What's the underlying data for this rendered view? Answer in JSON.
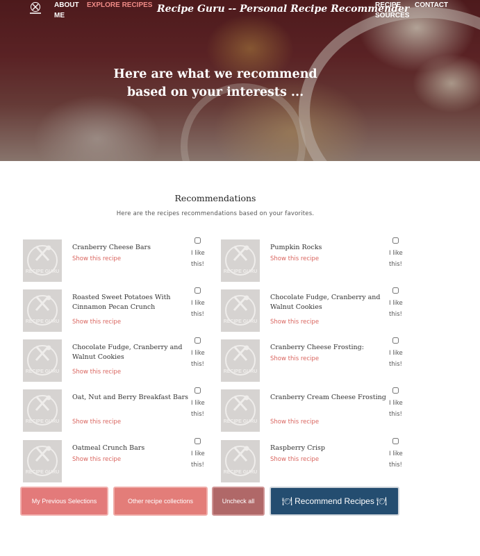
{
  "header": {
    "nav": {
      "about": "ABOUT ME",
      "explore": "EXPLORE RECIPES",
      "sources": "RECIPE SOURCES",
      "contact": "CONTACT"
    },
    "site_title": "Recipe Guru -- Personal Recipe Recommender",
    "hero_heading": "Here are what we recommend based on your interests ..."
  },
  "section": {
    "title": "Recommendations",
    "subtitle": "Here are the recipes recommendations based on your favorites."
  },
  "thumb_text": "RECIPE GURU",
  "recipes": [
    {
      "title": "Cranberry Cheese Bars",
      "link": "Show this recipe",
      "like": "I like this!"
    },
    {
      "title": "Pumpkin Rocks",
      "link": "Show this recipe",
      "like": "I like this!"
    },
    {
      "title": "Roasted Sweet Potatoes With Cinnamon Pecan Crunch",
      "link": "Show this recipe",
      "like": "I like this!"
    },
    {
      "title": "Chocolate Fudge, Cranberry and Walnut Cookies",
      "link": "Show this recipe",
      "like": "I like this!"
    },
    {
      "title": "Chocolate Fudge, Cranberry and Walnut Cookies",
      "link": "Show this recipe",
      "like": "I like this!"
    },
    {
      "title": "Cranberry Cheese Frosting:",
      "link": "Show this recipe",
      "like": "I like this!"
    },
    {
      "title": "Oat, Nut and Berry Breakfast Bars",
      "link": "Show this recipe",
      "like": "I like this!"
    },
    {
      "title": "Cranberry Cream Cheese Frosting",
      "link": "Show this recipe",
      "like": "I like this!"
    },
    {
      "title": "Oatmeal Crunch Bars",
      "link": "Show this recipe",
      "like": "I like this!"
    },
    {
      "title": "Raspberry Crisp",
      "link": "Show this recipe",
      "like": "I like this!"
    }
  ],
  "buttons": {
    "previous": "My Previous Selections",
    "other": "Other recipe collections",
    "uncheck": "Uncheck all",
    "recommend": "Recommend Recipes"
  },
  "colors": {
    "accent": "#e37a7a",
    "link": "#d9645e",
    "primary_button": "#244d70"
  },
  "icons": [
    "fork-spoon-icon",
    "bowl-icon"
  ]
}
